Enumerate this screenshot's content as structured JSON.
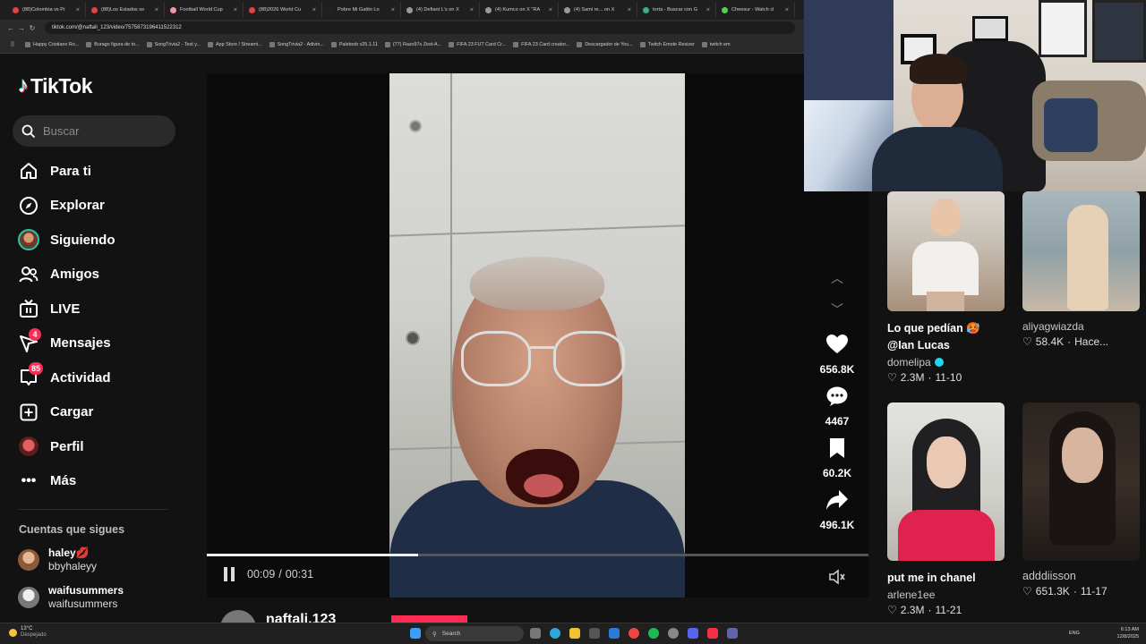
{
  "browser": {
    "tabs": [
      {
        "label": "(88)Colombia vs Pr",
        "color": "#d44"
      },
      {
        "label": "(88)Los Estados se",
        "color": "#d44"
      },
      {
        "label": "Football World Cup",
        "color": "#e9a"
      },
      {
        "label": "(88)2026 World Cu",
        "color": "#d44"
      },
      {
        "label": "Pobre Mi Gatito Lo",
        "color": "#222"
      },
      {
        "label": "(4) Defiant L's on X",
        "color": "#999"
      },
      {
        "label": "(4) Kumco on X \"RA",
        "color": "#999"
      },
      {
        "label": "(4) Sami re... on X",
        "color": "#999"
      },
      {
        "label": "torta - Buscar con G",
        "color": "#4a8"
      },
      {
        "label": "Cheesur - Watch cl",
        "color": "#5c5"
      }
    ],
    "url": "tiktok.com/@naftali_123/video/7575873196411522312",
    "bookmarks": [
      "Happy Cristiano Ro...",
      "Burago figura de to...",
      "SongTrivia2 - Test y...",
      "App Store / Streami...",
      "SongTrivia2 - Adivin...",
      "Paletoob v25.1.11",
      "(77) Razo97s Zest-A...",
      "FIFA 23 FUT Card Cr...",
      "FIFA 23 Card creator...",
      "Descargador de You...",
      "Twitch Emote Resizer",
      "twitch em"
    ]
  },
  "tiktok": {
    "logo_text": "TikTok",
    "search_placeholder": "Buscar",
    "nav": [
      {
        "label": "Para ti",
        "icon": "home-icon"
      },
      {
        "label": "Explorar",
        "icon": "compass-icon"
      },
      {
        "label": "Siguiendo",
        "icon": "following-avatar"
      },
      {
        "label": "Amigos",
        "icon": "friends-icon"
      },
      {
        "label": "LIVE",
        "icon": "live-icon"
      },
      {
        "label": "Mensajes",
        "icon": "messages-icon",
        "badge": "4"
      },
      {
        "label": "Actividad",
        "icon": "activity-icon",
        "badge": "85"
      },
      {
        "label": "Cargar",
        "icon": "upload-icon"
      },
      {
        "label": "Perfil",
        "icon": "profile-avatar"
      },
      {
        "label": "Más",
        "icon": "more-icon"
      }
    ],
    "following_title": "Cuentas que sigues",
    "following": [
      {
        "name": "haley💋",
        "handle": "bbyhaleyy"
      },
      {
        "name": "waifusummers",
        "handle": "waifusummers"
      }
    ],
    "player": {
      "current_time": "00:09",
      "separator": "/",
      "duration": "00:31",
      "progress": 0.32,
      "author": "naftali.123"
    },
    "actions": {
      "likes": "656.8K",
      "comments": "4467",
      "saves": "60.2K",
      "shares": "496.1K"
    },
    "cards": [
      {
        "title": "Lo que pedían 🥵 @Ian Lucas",
        "user": "domelipa",
        "verified": true,
        "likes": "2.3M",
        "date": "11-10"
      },
      {
        "title": "",
        "user": "aliyagwiazda",
        "likes": "58.4K",
        "date": "Hace..."
      },
      {
        "title": "put me in chanel",
        "user": "arlene1ee",
        "likes": "2.3M",
        "date": "11-21"
      },
      {
        "title": "",
        "user": "adddiisson",
        "likes": "651.3K",
        "date": "11-17"
      }
    ]
  },
  "taskbar": {
    "temp": "13°C",
    "weather": "Despejado",
    "search": "Search",
    "lang": "ENG",
    "time": "6:13 AM",
    "date": "12/8/2025"
  }
}
